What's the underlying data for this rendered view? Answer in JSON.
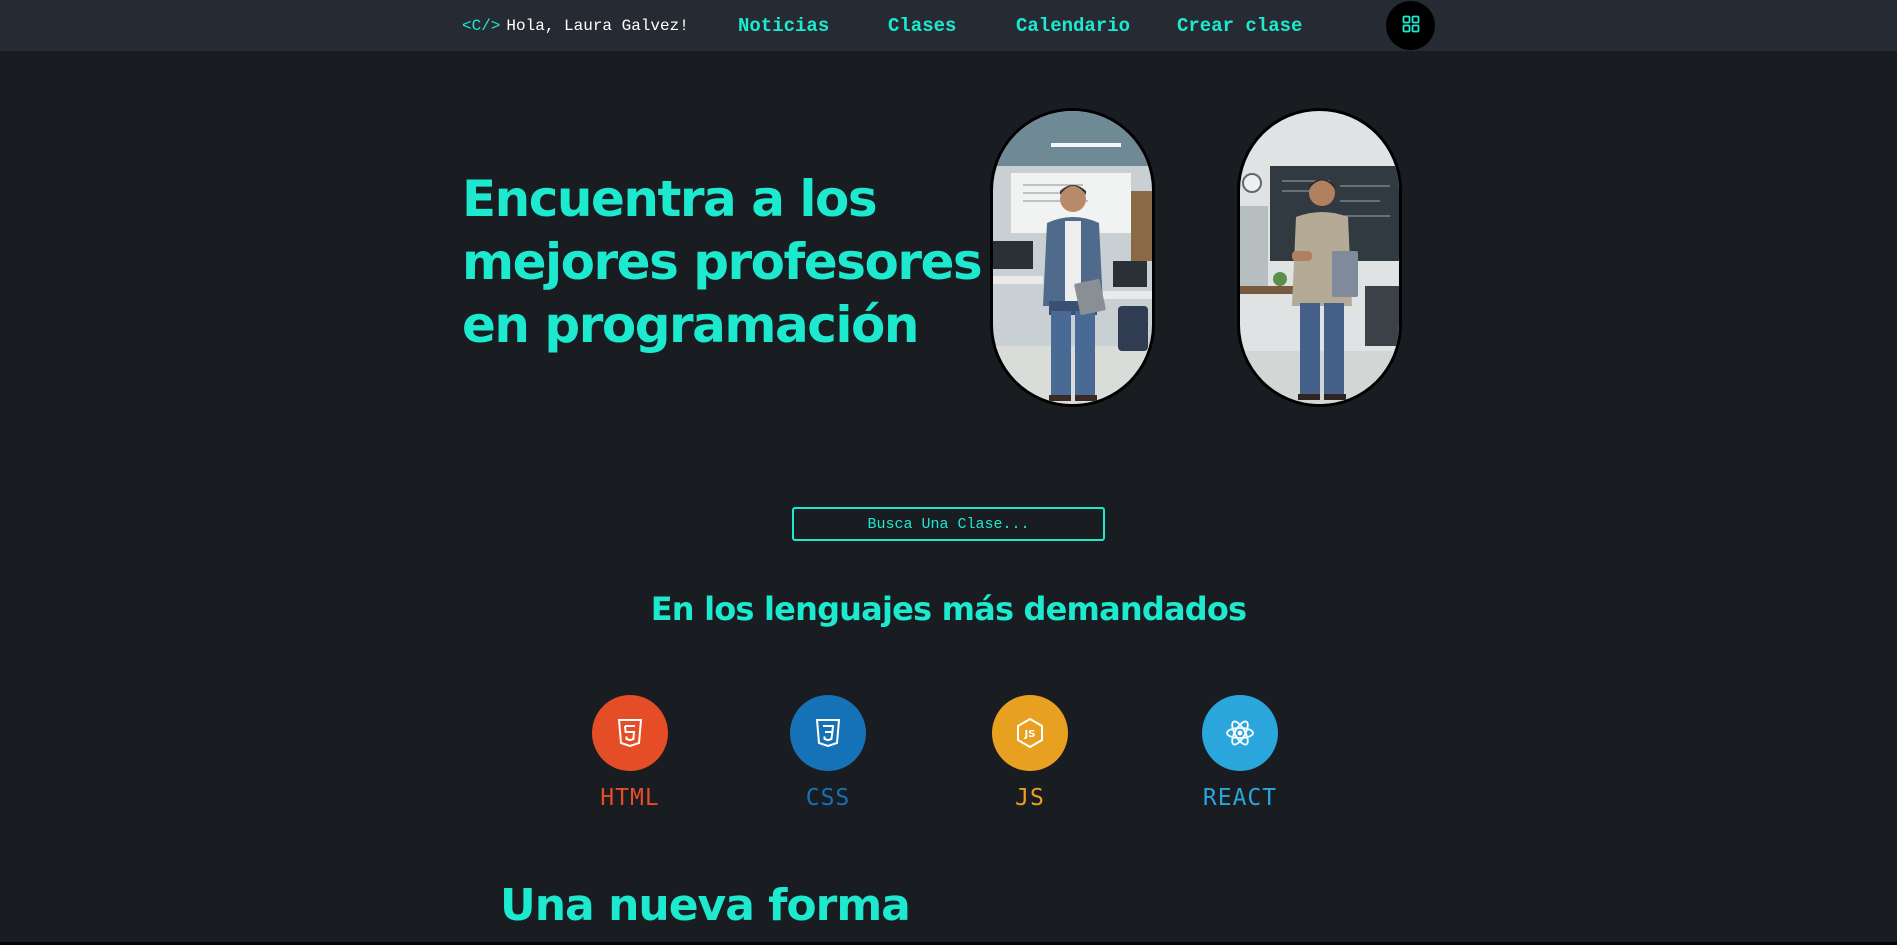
{
  "nav": {
    "logo": "<C/>",
    "greeting": "Hola, Laura Galvez!",
    "links": [
      "Noticias",
      "Clases",
      "Calendario",
      "Crear clase"
    ],
    "menu_icon": "grid-icon"
  },
  "hero": {
    "title_lines": [
      "Encuentra a los",
      "mejores profesores",
      "en programación"
    ]
  },
  "search": {
    "label": "Busca Una Clase..."
  },
  "languages_section": {
    "heading": "En los lenguajes más demandados",
    "items": [
      {
        "label": "HTML",
        "icon": "html5-icon",
        "color": "#e44d26"
      },
      {
        "label": "CSS",
        "icon": "css3-icon",
        "color": "#1572b6"
      },
      {
        "label": "JS",
        "icon": "js-icon",
        "color": "#e8a020"
      },
      {
        "label": "REACT",
        "icon": "react-icon",
        "color": "#2aa6dc"
      }
    ]
  },
  "next_section": {
    "heading": "Una nueva forma"
  },
  "colors": {
    "accent": "#1de9cf",
    "background": "#191c21",
    "navbar": "#262b33"
  }
}
